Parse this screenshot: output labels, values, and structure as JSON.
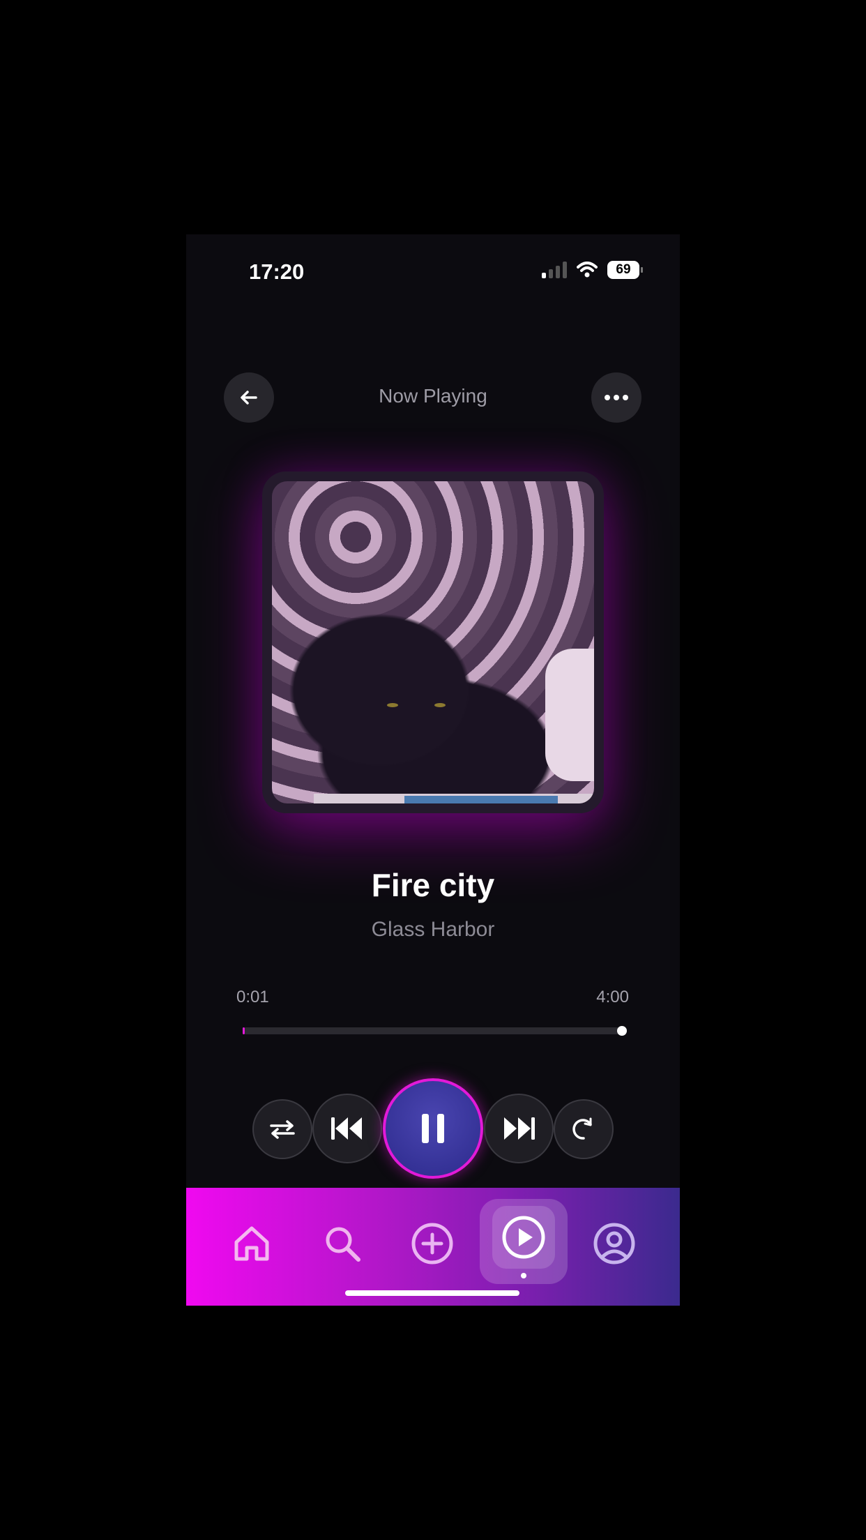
{
  "status_bar": {
    "time": "17:20",
    "battery": "69"
  },
  "header": {
    "title": "Now Playing",
    "back_icon": "arrow-left-icon",
    "more_icon": "more-horizontal-icon"
  },
  "track": {
    "title": "Fire city",
    "artist": "Glass Harbor"
  },
  "progress": {
    "elapsed": "0:01",
    "total": "4:00",
    "fraction": 0.004
  },
  "controls": {
    "shuffle_icon": "shuffle-icon",
    "previous_icon": "skip-back-icon",
    "play_state": "playing",
    "pause_icon": "pause-icon",
    "next_icon": "skip-forward-icon",
    "repeat_icon": "repeat-icon"
  },
  "tab_bar": {
    "items": [
      "home-icon",
      "search-icon",
      "add-circle-icon",
      "play-circle-icon",
      "profile-icon"
    ],
    "active": "play-circle-icon"
  },
  "colors": {
    "accent": "#e21ad8",
    "background": "#0c0b10",
    "play_button": "#3b37a0"
  }
}
